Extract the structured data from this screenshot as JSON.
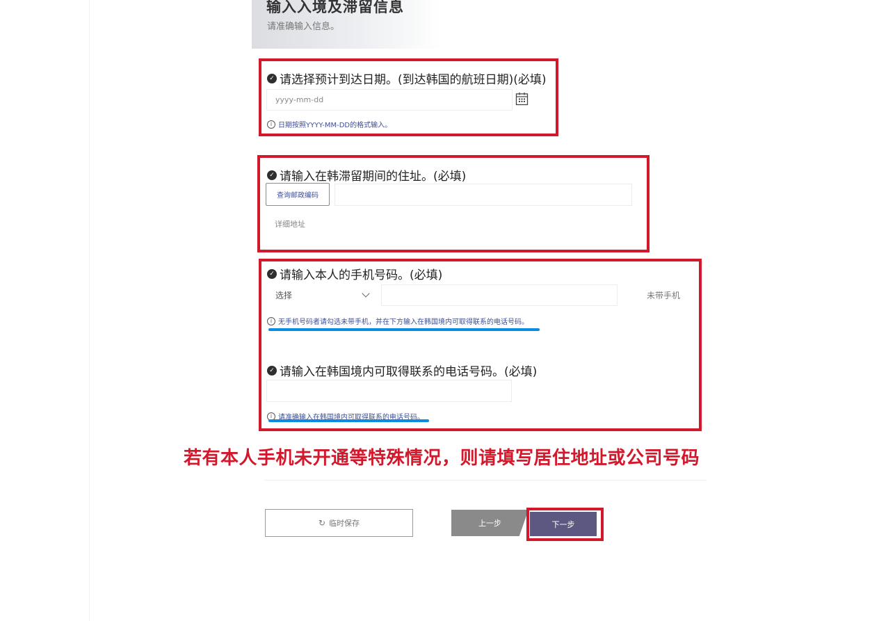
{
  "header": {
    "title": "输入入境及滞留信息",
    "subtitle": "请准确输入信息。"
  },
  "arrival": {
    "question": "请选择预计到达日期。(到达韩国的航班日期)(必填)",
    "placeholder": "yyyy-mm-dd",
    "hint": "日期按照YYYY-MM-DD的格式输入。"
  },
  "address": {
    "question": "请输入在韩滞留期间的住址。(必填)",
    "postal_button": "查询邮政编码",
    "detail_placeholder": "详细地址"
  },
  "phone": {
    "question": "请输入本人的手机号码。(必填)",
    "select_value": "选择",
    "no_phone_label": "未带手机",
    "hint": "无手机号码者请勾选未带手机，并在下方输入在韩国境内可取得联系的电话号码。"
  },
  "contact": {
    "question": "请输入在韩国境内可取得联系的电话号码。(必填)",
    "hint": "请准确输入在韩国境内可取得联系的电话号码。"
  },
  "notice": "若有本人手机未开通等特殊情况，则请填写居住地址或公司号码",
  "footer": {
    "save_label": "临时保存",
    "prev_label": "上一步",
    "next_label": "下一步"
  },
  "colors": {
    "highlight_red": "#d3182c",
    "underline_blue": "#0a8de0",
    "next_button": "#5d5882",
    "prev_button": "#8a8a8a",
    "hint_text": "#3d4f95"
  }
}
